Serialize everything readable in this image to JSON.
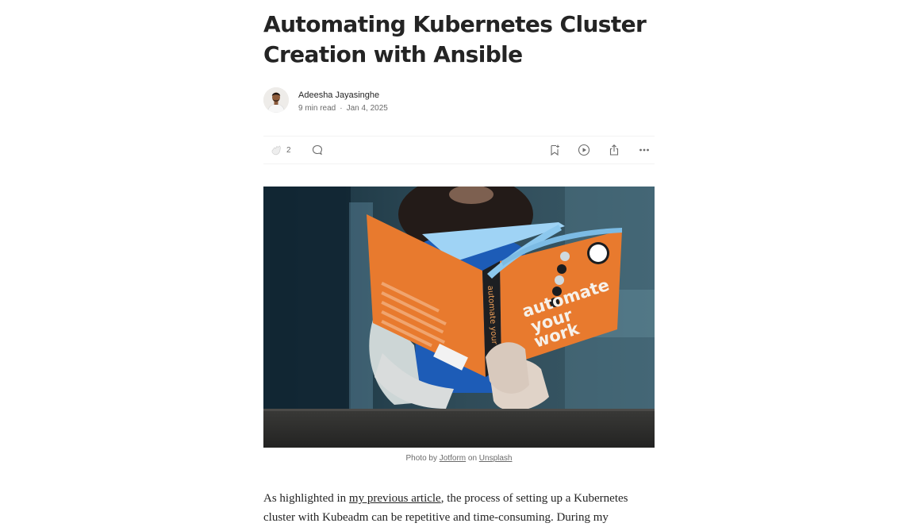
{
  "article": {
    "title": "Automating Kubernetes Cluster Creation with Ansible",
    "author": {
      "name": "Adeesha Jayasinghe",
      "read_time": "9 min read",
      "separator": "·",
      "date": "Jan 4, 2025"
    },
    "actions": {
      "clap_count": "2",
      "icons": [
        "clap-icon",
        "comment-icon",
        "bookmark-icon",
        "play-icon",
        "share-icon",
        "more-icon"
      ]
    },
    "hero_caption": {
      "prefix": "Photo by",
      "photographer": "Jotform",
      "middle": "on",
      "source": "Unsplash"
    },
    "hero_book_text": {
      "cover_title_1": "automate",
      "cover_title_2": "your",
      "cover_title_3": "work",
      "spine": "automate your work"
    },
    "body": {
      "p1_start": "As highlighted in",
      "p1_link": "my previous article",
      "p1_end": ", the process of setting up a Kubernetes",
      "p1_line2": "cluster with Kubeadm can be repetitive and time-consuming. During my"
    }
  },
  "colors": {
    "text": "#242424",
    "muted": "#6b6b6b",
    "book_orange": "#e87a2e",
    "book_pages": "#6fb3e8"
  }
}
